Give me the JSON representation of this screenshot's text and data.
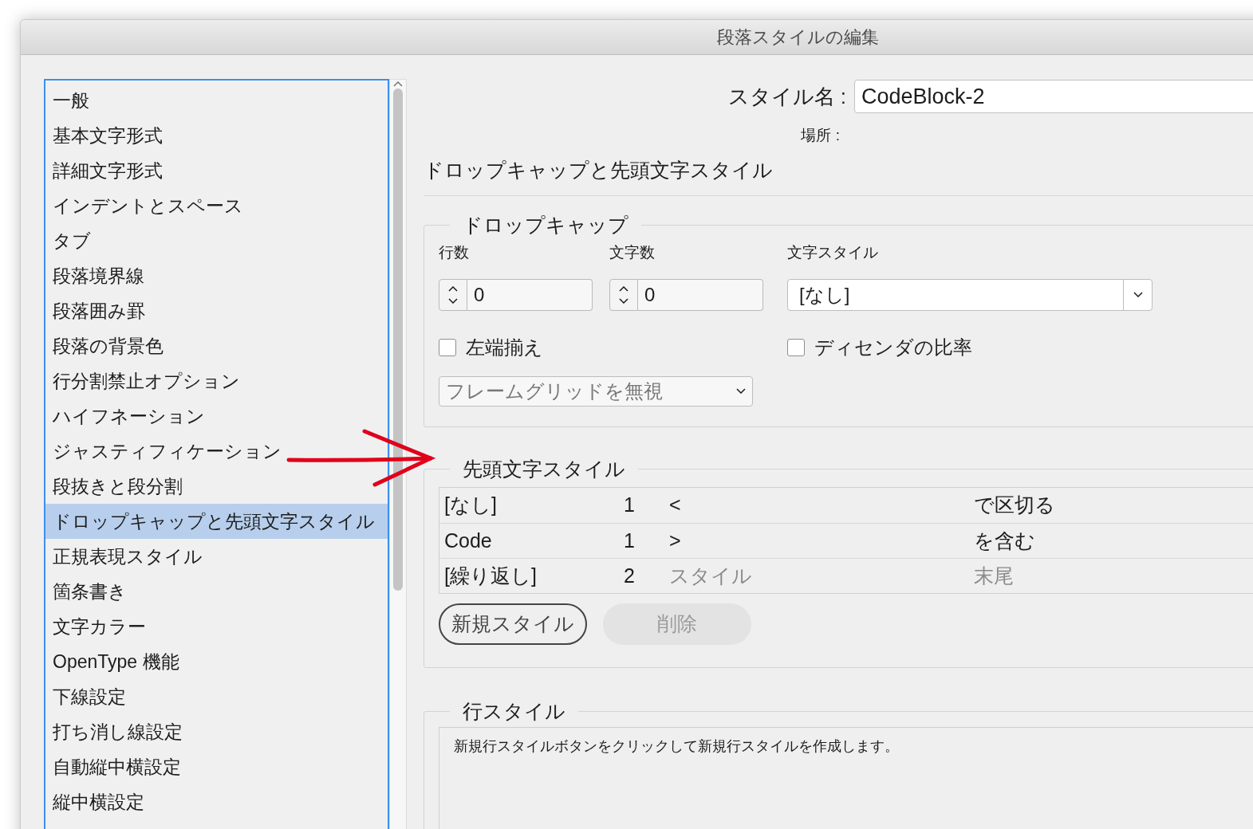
{
  "window": {
    "title": "段落スタイルの編集"
  },
  "sidebar": {
    "items": [
      {
        "label": "一般",
        "selected": false
      },
      {
        "label": "基本文字形式",
        "selected": false
      },
      {
        "label": "詳細文字形式",
        "selected": false
      },
      {
        "label": "インデントとスペース",
        "selected": false
      },
      {
        "label": "タブ",
        "selected": false
      },
      {
        "label": "段落境界線",
        "selected": false
      },
      {
        "label": "段落囲み罫",
        "selected": false
      },
      {
        "label": "段落の背景色",
        "selected": false
      },
      {
        "label": "行分割禁止オプション",
        "selected": false
      },
      {
        "label": "ハイフネーション",
        "selected": false
      },
      {
        "label": "ジャスティフィケーション",
        "selected": false
      },
      {
        "label": "段抜きと段分割",
        "selected": false
      },
      {
        "label": "ドロップキャップと先頭文字スタイル",
        "selected": true
      },
      {
        "label": "正規表現スタイル",
        "selected": false
      },
      {
        "label": "箇条書き",
        "selected": false
      },
      {
        "label": "文字カラー",
        "selected": false
      },
      {
        "label": "OpenType 機能",
        "selected": false
      },
      {
        "label": "下線設定",
        "selected": false
      },
      {
        "label": "打ち消し線設定",
        "selected": false
      },
      {
        "label": "自動縦中横設定",
        "selected": false
      },
      {
        "label": "縦中横設定",
        "selected": false
      }
    ]
  },
  "style_name": {
    "label": "スタイル名 :",
    "value": "CodeBlock-2"
  },
  "location": {
    "label": "場所 :"
  },
  "section_title": "ドロップキャップと先頭文字スタイル",
  "drop_cap": {
    "title": "ドロップキャップ",
    "lines": {
      "label": "行数",
      "value": "0"
    },
    "chars": {
      "label": "文字数",
      "value": "0"
    },
    "char_style": {
      "label": "文字スタイル",
      "value": "[なし]"
    },
    "align_left": {
      "label": "左端揃え",
      "checked": false
    },
    "descender": {
      "label": "ディセンダの比率",
      "checked": false
    },
    "grid": {
      "value": "フレームグリッドを無視"
    }
  },
  "nested_styles": {
    "title": "先頭文字スタイル",
    "rows": [
      {
        "cells": [
          {
            "text": "[なし]",
            "disabled": false
          },
          {
            "text": "1",
            "disabled": false
          },
          {
            "text": "<",
            "disabled": false
          },
          {
            "text": "で区切る",
            "disabled": false
          }
        ]
      },
      {
        "cells": [
          {
            "text": "Code",
            "disabled": false
          },
          {
            "text": "1",
            "disabled": false
          },
          {
            "text": ">",
            "disabled": false
          },
          {
            "text": "を含む",
            "disabled": false
          }
        ]
      },
      {
        "cells": [
          {
            "text": "[繰り返し]",
            "disabled": false
          },
          {
            "text": "2",
            "disabled": false
          },
          {
            "text": "スタイル",
            "disabled": true
          },
          {
            "text": "末尾",
            "disabled": true
          }
        ]
      }
    ],
    "buttons": [
      {
        "label": "新規スタイル",
        "disabled": false
      },
      {
        "label": "削除",
        "disabled": true
      }
    ]
  },
  "line_styles": {
    "title": "行スタイル",
    "message": "新規行スタイルボタンをクリックして新規行スタイルを作成します。"
  }
}
